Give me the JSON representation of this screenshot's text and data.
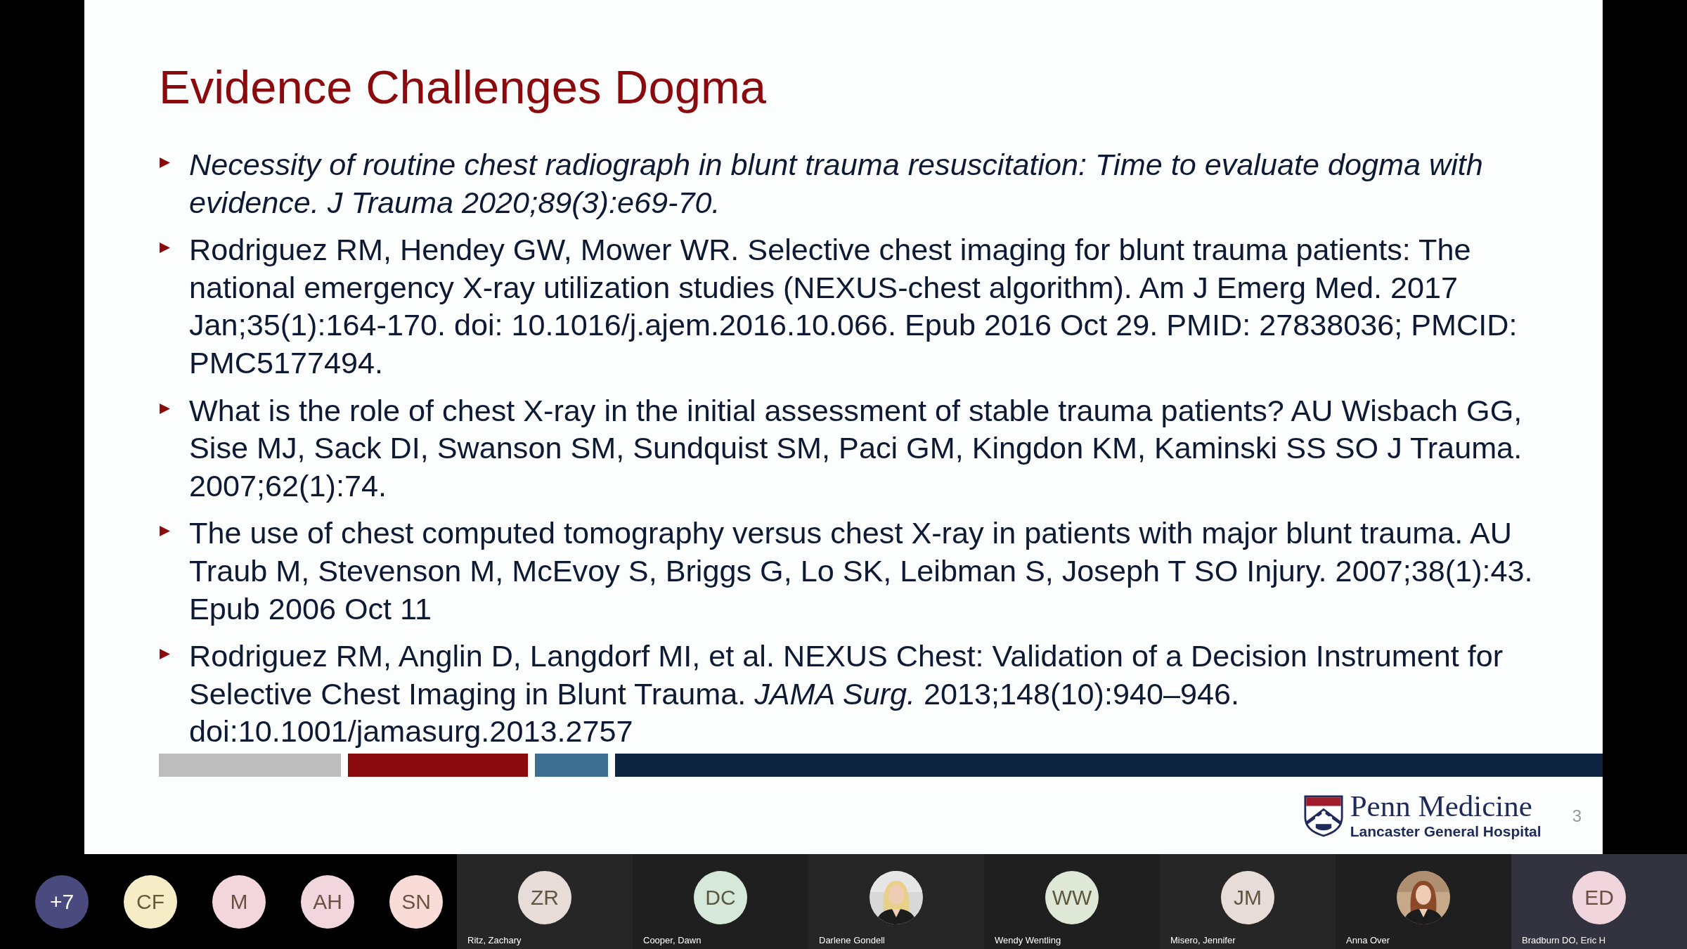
{
  "slide": {
    "title": "Evidence Challenges Dogma",
    "references": [
      {
        "text": "Necessity of routine chest radiograph in blunt trauma resuscitation: Time to evaluate dogma with evidence. J Trauma 2020;89(3):e69-70.",
        "italic": true
      },
      {
        "text": "Rodriguez RM, Hendey GW, Mower WR. Selective chest imaging for blunt trauma patients: The national emergency X-ray utilization studies (NEXUS-chest algorithm). Am J Emerg Med. 2017 Jan;35(1):164-170. doi: 10.1016/j.ajem.2016.10.066. Epub 2016 Oct 29. PMID: 27838036; PMCID: PMC5177494.",
        "italic": false
      },
      {
        "text": "What is the role of chest X-ray in the initial assessment of stable trauma patients? AU Wisbach GG, Sise MJ, Sack DI, Swanson SM, Sundquist SM, Paci GM, Kingdon KM, Kaminski SS  SO J Trauma. 2007;62(1):74.",
        "italic": false
      },
      {
        "text": "The use of chest computed tomography versus chest X-ray in patients with major blunt trauma. AU Traub M, Stevenson M, McEvoy S, Briggs G, Lo SK, Leibman S, Joseph T  SO Injury. 2007;38(1):43. Epub 2006 Oct 11",
        "italic": false
      },
      {
        "text": "Rodriguez RM, Anglin D, Langdorf MI, et al. NEXUS Chest: Validation of a Decision Instrument for Selective Chest Imaging in Blunt Trauma. *JAMA Surg.* 2013;148(10):940–946. doi:10.1001/jamasurg.2013.2757",
        "italic": false
      }
    ],
    "bars": [
      {
        "color": "#bdbdbd"
      },
      {
        "color": "#8b0a0e"
      },
      {
        "color": "#3d6f92"
      },
      {
        "color": "#0d2440"
      }
    ],
    "logo": {
      "name": "Penn Medicine",
      "subtitle": "Lancaster General Hospital"
    },
    "page_number": "3"
  },
  "avatar_strip": [
    {
      "initials": "+7",
      "color": "#4b4a7e"
    },
    {
      "initials": "CF",
      "color": "#f6ecc6"
    },
    {
      "initials": "M",
      "color": "#f2d6dc"
    },
    {
      "initials": "AH",
      "color": "#f2d6dd"
    },
    {
      "initials": "SN",
      "color": "#f9dcd8"
    }
  ],
  "tiles": [
    {
      "name": "Ritz, Zachary",
      "kind": "initials",
      "initials": "ZR",
      "color": "#e8dcd8",
      "highlighted": false
    },
    {
      "name": "Cooper, Dawn",
      "kind": "initials",
      "initials": "DC",
      "color": "#d6e8da",
      "highlighted": false
    },
    {
      "name": "Darlene Gondell",
      "kind": "picture",
      "highlighted": false
    },
    {
      "name": "Wendy Wentling",
      "kind": "initials",
      "initials": "WW",
      "color": "#dfe8d6",
      "highlighted": false
    },
    {
      "name": "Misero, Jennifer",
      "kind": "initials",
      "initials": "JM",
      "color": "#e8dcd9",
      "highlighted": false
    },
    {
      "name": "Anna Over",
      "kind": "picture",
      "highlighted": false
    },
    {
      "name": "Bradburn DO, Eric H",
      "kind": "initials",
      "initials": "ED",
      "color": "#f0d6dc",
      "highlighted": true
    }
  ]
}
